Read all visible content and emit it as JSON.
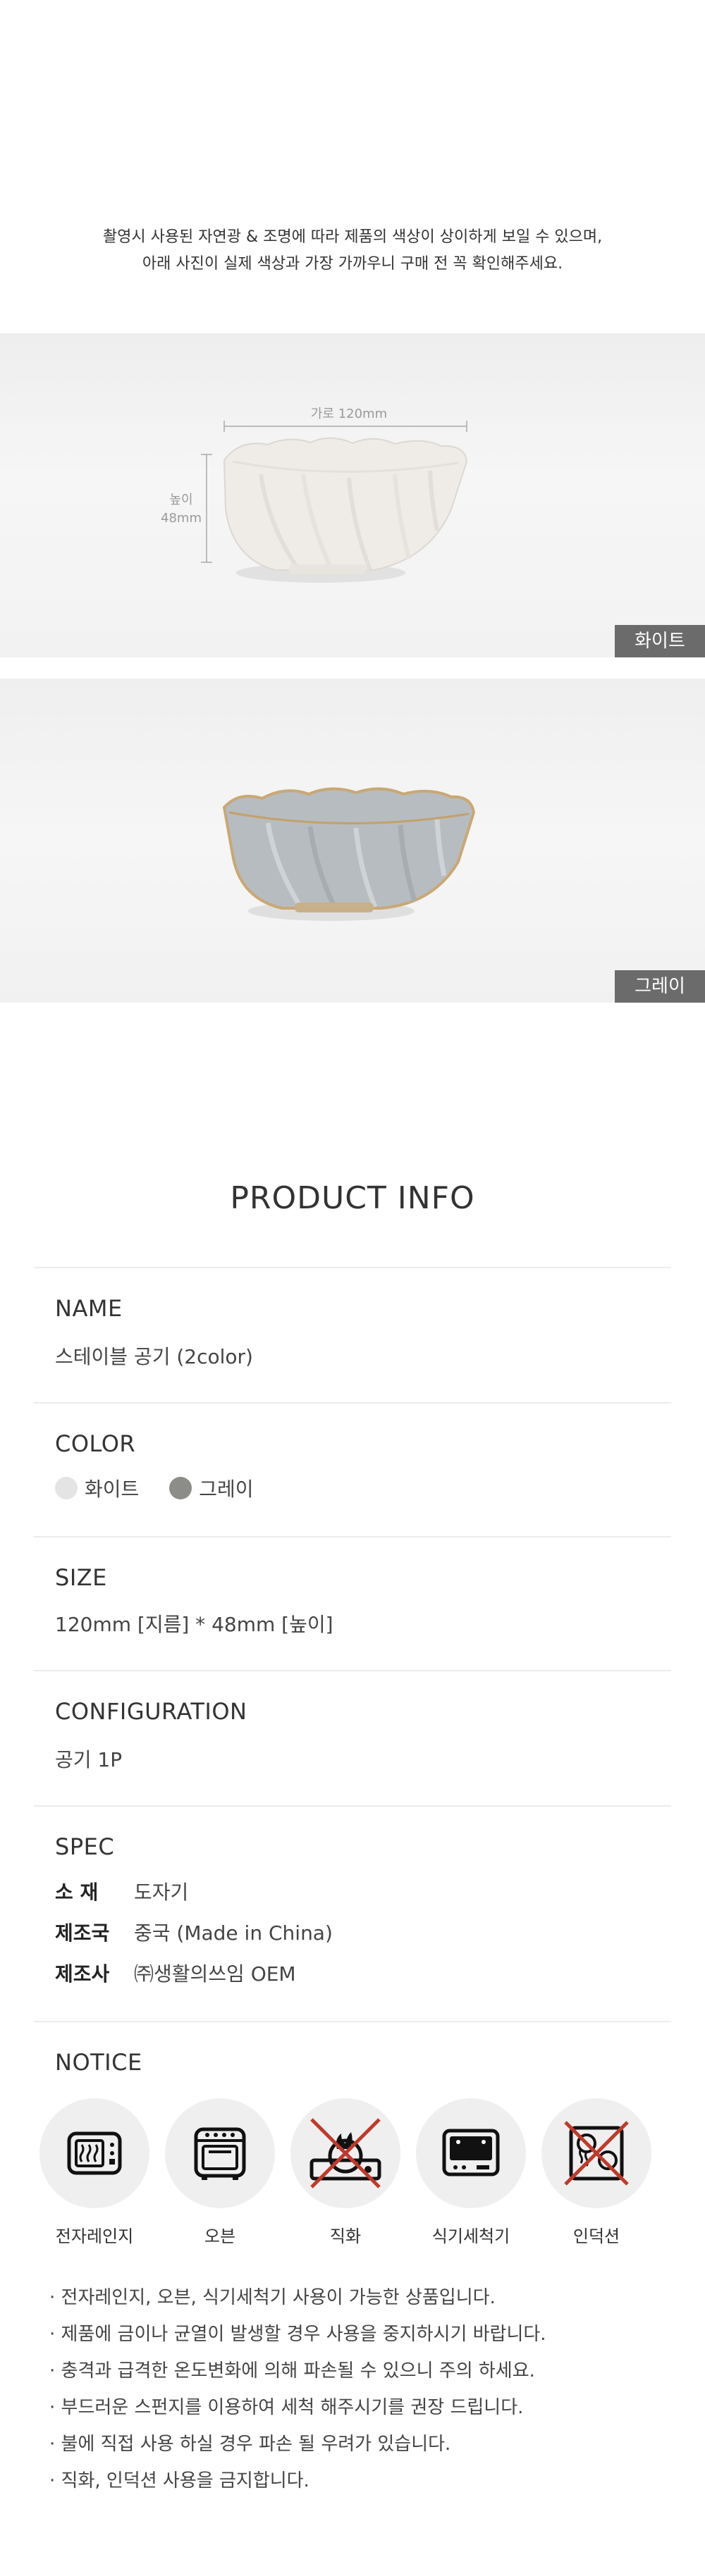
{
  "color_notice": {
    "line1": "촬영시 사용된 자연광 & 조명에 따라 제품의 색상이 상이하게 보일 수 있으며,",
    "line2": "아래 사진이 실제 색상과 가장 가까우니 구매 전 꼭 확인해주세요."
  },
  "photos": {
    "white": {
      "tag": "화이트",
      "width_label": "가로 120mm",
      "height_label_1": "높이",
      "height_label_2": "48mm"
    },
    "gray": {
      "tag": "그레이"
    }
  },
  "product_info": {
    "title": "PRODUCT INFO",
    "name": {
      "label": "NAME",
      "value": "스테이블 공기 (2color)"
    },
    "color": {
      "label": "COLOR",
      "options": [
        {
          "name": "화이트",
          "swatch": "#e4e4e4"
        },
        {
          "name": "그레이",
          "swatch": "#8c8c88"
        }
      ]
    },
    "size": {
      "label": "SIZE",
      "value": "120mm [지름] * 48mm [높이]"
    },
    "configuration": {
      "label": "CONFIGURATION",
      "value": "공기 1P"
    },
    "spec": {
      "label": "SPEC",
      "items": [
        {
          "key": "소   재",
          "value": "도자기"
        },
        {
          "key": "제조국",
          "value": "중국 (Made in China)"
        },
        {
          "key": "제조사",
          "value": "㈜생활의쓰임 OEM"
        }
      ]
    },
    "notice": {
      "label": "NOTICE",
      "icons": [
        {
          "label": "전자레인지",
          "icon": "microwave-icon",
          "allowed": true
        },
        {
          "label": "오븐",
          "icon": "oven-icon",
          "allowed": true
        },
        {
          "label": "직화",
          "icon": "gas-stove-icon",
          "allowed": false
        },
        {
          "label": "식기세척기",
          "icon": "dishwasher-icon",
          "allowed": true
        },
        {
          "label": "인덕션",
          "icon": "induction-icon",
          "allowed": false
        }
      ],
      "lines": [
        "전자레인지, 오븐, 식기세척기 사용이 가능한 상품입니다.",
        "제품에 금이나 균열이 발생할 경우 사용을 중지하시기 바랍니다.",
        "충격과 급격한 온도변화에 의해 파손될 수 있으니 주의 하세요.",
        "부드러운 스펀지를 이용하여 세척 해주시기를 권장 드립니다.",
        "불에 직접 사용 하실 경우 파손 될 우려가 있습니다.",
        "직화, 인덕션 사용을 금지합니다."
      ]
    }
  },
  "colors": {
    "prohibit": "#c0392b",
    "tag_bg": "#6b6b6b"
  }
}
